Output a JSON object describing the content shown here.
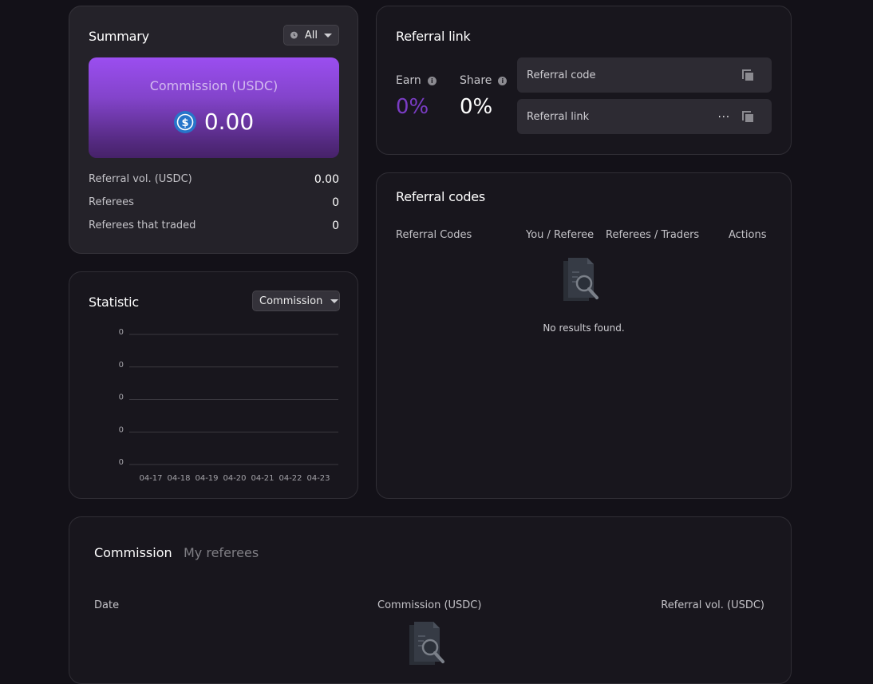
{
  "summary": {
    "title": "Summary",
    "filter_label": "All",
    "commission_label": "Commission (USDC)",
    "commission_value": "0.00",
    "rows": [
      {
        "label": "Referral vol. (USDC)",
        "value": "0.00"
      },
      {
        "label": "Referees",
        "value": "0"
      },
      {
        "label": "Referees that traded",
        "value": "0"
      }
    ],
    "icons": {
      "filter": "clock-icon",
      "currency": "usdc-coin-icon"
    }
  },
  "statistic": {
    "title": "Statistic",
    "dropdown_label": "Commission"
  },
  "chart_data": {
    "type": "line",
    "categories": [
      "04-17",
      "04-18",
      "04-19",
      "04-20",
      "04-21",
      "04-22",
      "04-23"
    ],
    "series": [
      {
        "values": [
          0,
          0,
          0,
          0,
          0,
          0,
          0
        ]
      }
    ],
    "y_ticks": [
      "0",
      "0",
      "0",
      "0",
      "0"
    ],
    "ylim": [
      0,
      0
    ],
    "grid": true
  },
  "referral_link": {
    "title": "Referral link",
    "earn_label": "Earn",
    "earn_value": "0%",
    "share_label": "Share",
    "share_value": "0%",
    "code_field": "Referral code",
    "link_field": "Referral link",
    "link_truncated": "...",
    "colors": {
      "earn_value": "#7a3cc4"
    }
  },
  "referral_codes": {
    "title": "Referral codes",
    "columns": [
      "Referral Codes",
      "You / Referee",
      "Referees / Traders",
      "Actions"
    ],
    "empty_text": "No results found."
  },
  "bottom": {
    "tabs": [
      {
        "label": "Commission",
        "active": true
      },
      {
        "label": "My referees",
        "active": false
      }
    ],
    "columns": [
      "Date",
      "Commission (USDC)",
      "Referral vol. (USDC)"
    ]
  }
}
